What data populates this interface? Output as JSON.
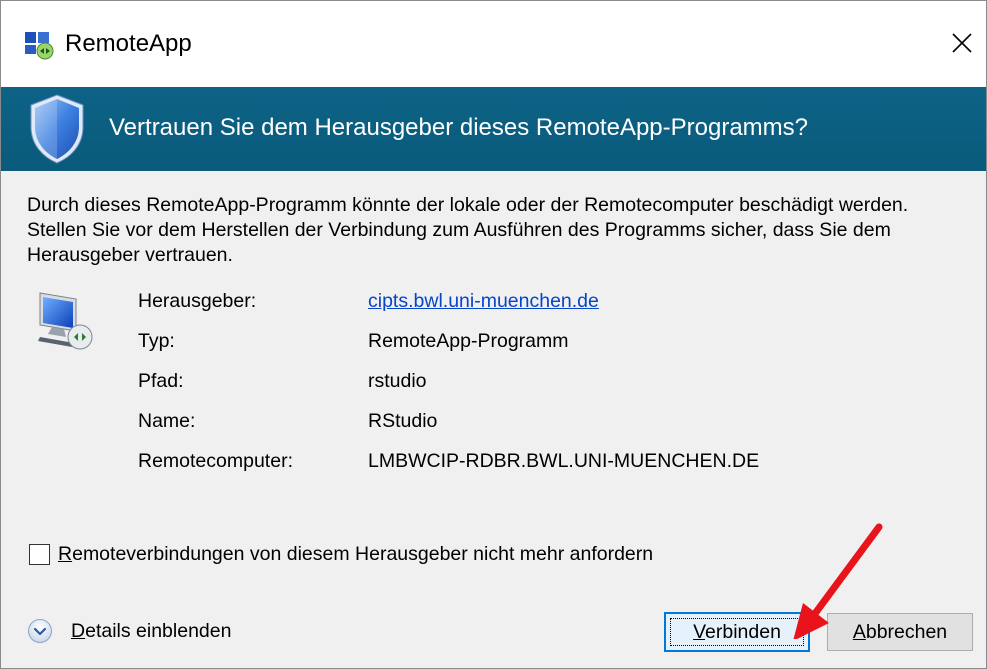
{
  "window": {
    "title": "RemoteApp",
    "close_symbol": "✕"
  },
  "banner": {
    "heading": "Vertrauen Sie dem Herausgeber dieses RemoteApp-Programms?"
  },
  "warning_text": "Durch dieses RemoteApp-Programm könnte der lokale oder der Remotecomputer beschädigt werden. Stellen Sie vor dem Herstellen der Verbindung zum Ausführen des Programms sicher, dass Sie dem Herausgeber vertrauen.",
  "details": [
    {
      "label": "Herausgeber:",
      "value": "cipts.bwl.uni-muenchen.de"
    },
    {
      "label": "Typ:",
      "value": "RemoteApp-Programm"
    },
    {
      "label": "Pfad:",
      "value": "rstudio"
    },
    {
      "label": "Name:",
      "value": "RStudio"
    },
    {
      "label": "Remotecomputer:",
      "value": "LMBWCIP-RDBR.BWL.UNI-MUENCHEN.DE"
    }
  ],
  "checkbox": {
    "label_first": "R",
    "label_rest": "emoteverbindungen von diesem Herausgeber nicht mehr anfordern",
    "checked": false
  },
  "details_toggle": {
    "label_first": "D",
    "label_rest": "etails einblenden"
  },
  "buttons": {
    "connect_first": "V",
    "connect_rest": "erbinden",
    "cancel_first": "A",
    "cancel_rest": "bbrechen"
  },
  "icons": {
    "app": "remoteapp-icon",
    "close": "close-icon",
    "shield": "shield-icon",
    "computer": "remote-computer-icon",
    "expand": "chevron-down-circle-icon",
    "annotation": "red-arrow-annotation"
  },
  "colors": {
    "banner": "#0d6386",
    "link": "#0645c8",
    "primary_border": "#0078d7",
    "arrow": "#e8131b"
  }
}
